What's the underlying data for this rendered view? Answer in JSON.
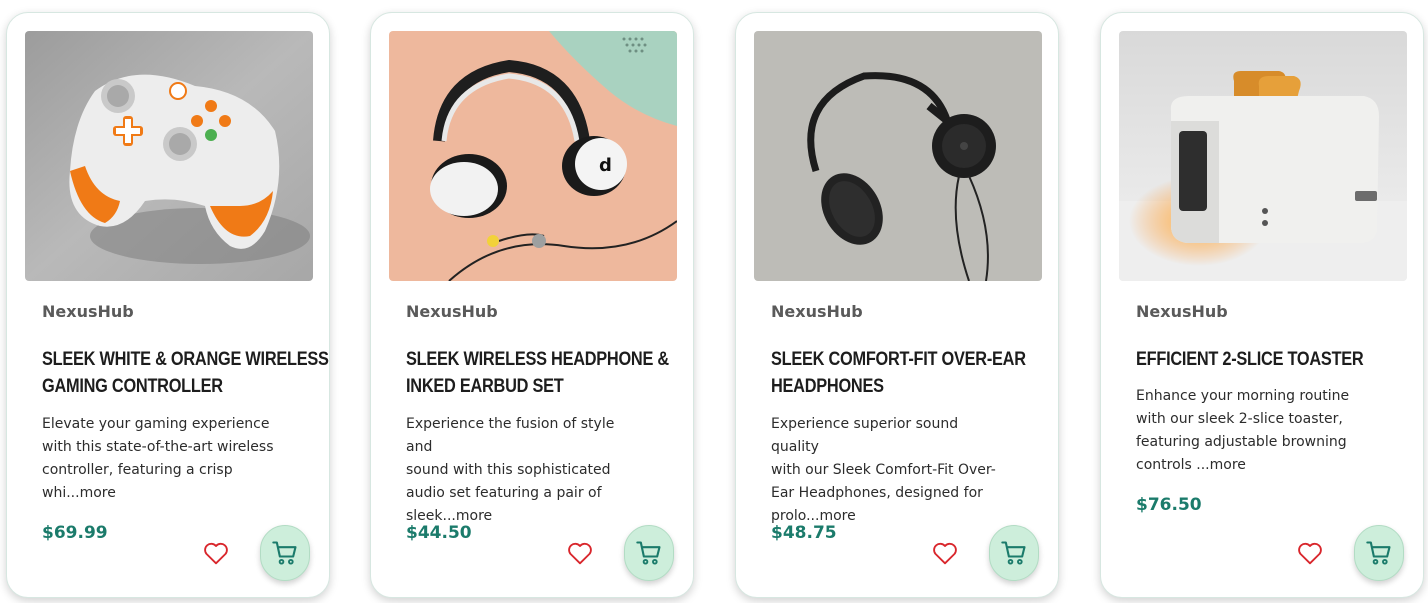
{
  "colors": {
    "price": "#1b7b6b",
    "cart_button_bg": "#cdeedb",
    "heart": "#d9262c",
    "cart_icon": "#1b7b6b"
  },
  "products": [
    {
      "brand": "NexusHub",
      "title_lines": [
        "SLEEK WHITE & ORANGE WIRELESS",
        "GAMING CONTROLLER"
      ],
      "description": "Elevate your gaming experience with this state-of-the-art wireless controller, featuring a crisp whi...",
      "description_lines": [
        "Elevate your gaming experience",
        "with this state-of-the-art wireless",
        "controller, featuring a crisp",
        "whi..."
      ],
      "more_label": "more",
      "price": "$69.99",
      "image_icon": "game-controller",
      "favorite_icon": "heart-icon",
      "cart_icon": "cart-icon"
    },
    {
      "brand": "NexusHub",
      "title_lines": [
        "SLEEK WIRELESS HEADPHONE &",
        "INKED EARBUD SET"
      ],
      "description": "Experience the fusion of style and sound with this sophisticated audio set featuring a pair of sleek...",
      "description_lines": [
        "Experience the fusion of style and",
        "sound with this sophisticated",
        "audio set featuring a pair of",
        "sleek..."
      ],
      "more_label": "more",
      "price": "$44.50",
      "image_icon": "headphones-earbuds",
      "favorite_icon": "heart-icon",
      "cart_icon": "cart-icon"
    },
    {
      "brand": "NexusHub",
      "title_lines": [
        "SLEEK COMFORT-FIT OVER-EAR",
        "HEADPHONES"
      ],
      "description": "Experience superior sound quality with our Sleek Comfort-Fit Over-Ear Headphones, designed for prolo...",
      "description_lines": [
        "Experience superior sound quality",
        "with our Sleek Comfort-Fit Over-",
        "Ear Headphones, designed for",
        "prolo..."
      ],
      "more_label": "more",
      "price": "$48.75",
      "image_icon": "over-ear-headphones",
      "favorite_icon": "heart-icon",
      "cart_icon": "cart-icon"
    },
    {
      "brand": "NexusHub",
      "title_lines": [
        "EFFICIENT 2-SLICE TOASTER"
      ],
      "description": "Enhance your morning routine with our sleek 2-slice toaster, featuring adjustable browning controls ...",
      "description_lines": [
        "Enhance your morning routine",
        "with our sleek 2-slice toaster,",
        "featuring adjustable browning",
        "controls ..."
      ],
      "more_label": "more",
      "price": "$76.50",
      "image_icon": "toaster",
      "favorite_icon": "heart-icon",
      "cart_icon": "cart-icon"
    }
  ]
}
